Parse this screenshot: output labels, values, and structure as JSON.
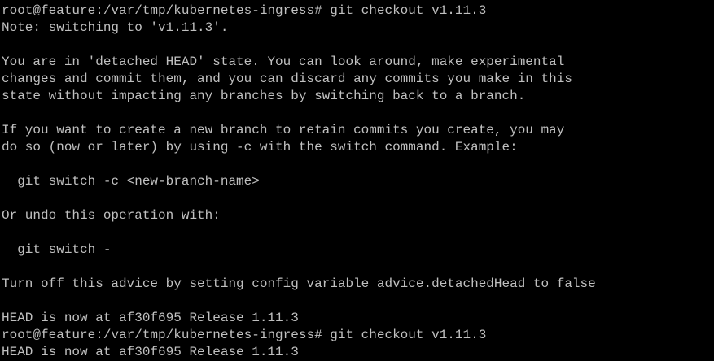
{
  "terminal": {
    "colors": {
      "background": "#000000",
      "foreground": "#c0c0c0"
    },
    "lines": [
      "root@feature:/var/tmp/kubernetes-ingress# git checkout v1.11.3",
      "Note: switching to 'v1.11.3'.",
      "",
      "You are in 'detached HEAD' state. You can look around, make experimental",
      "changes and commit them, and you can discard any commits you make in this",
      "state without impacting any branches by switching back to a branch.",
      "",
      "If you want to create a new branch to retain commits you create, you may",
      "do so (now or later) by using -c with the switch command. Example:",
      "",
      "  git switch -c <new-branch-name>",
      "",
      "Or undo this operation with:",
      "",
      "  git switch -",
      "",
      "Turn off this advice by setting config variable advice.detachedHead to false",
      "",
      "HEAD is now at af30f695 Release 1.11.3",
      "root@feature:/var/tmp/kubernetes-ingress# git checkout v1.11.3",
      "HEAD is now at af30f695 Release 1.11.3"
    ]
  }
}
